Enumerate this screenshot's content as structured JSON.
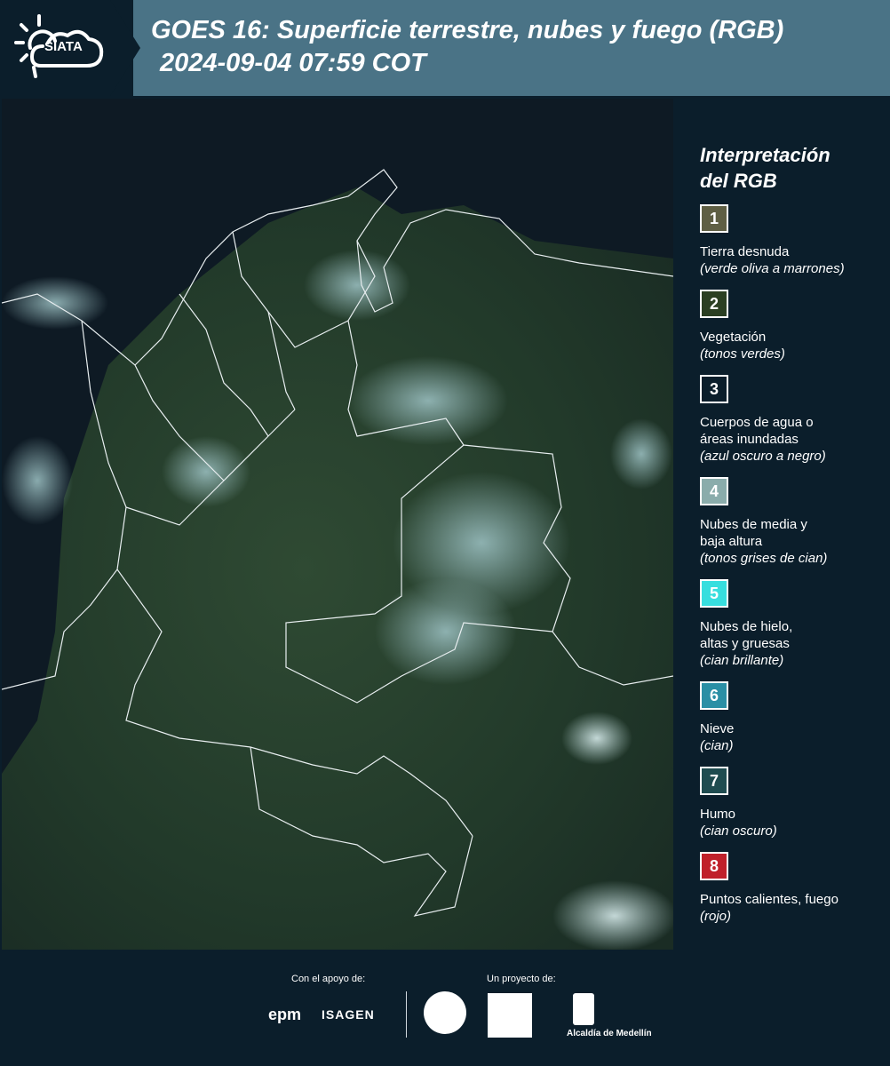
{
  "header": {
    "logo_text": "SIATA",
    "title": "GOES 16: Superficie terrestre, nubes y fuego (RGB)",
    "subtitle": "2024-09-04 07:59 COT"
  },
  "legend": {
    "title_line1": "Interpretación",
    "title_line2": "del RGB",
    "items": [
      {
        "num": "1",
        "color": "#5f5f44",
        "line1": "Tierra desnuda",
        "line2": "",
        "sub": "(verde oliva a marrones)"
      },
      {
        "num": "2",
        "color": "#2b3f22",
        "line1": "Vegetación",
        "line2": "",
        "sub": "(tonos verdes)"
      },
      {
        "num": "3",
        "color": "#0b1e2b",
        "line1": "Cuerpos de agua o",
        "line2": "áreas inundadas",
        "sub": "(azul oscuro a negro)"
      },
      {
        "num": "4",
        "color": "#8aacab",
        "line1": "Nubes de media y",
        "line2": "baja altura",
        "sub": "(tonos grises de cian)"
      },
      {
        "num": "5",
        "color": "#37dede",
        "line1": "Nubes de hielo,",
        "line2": "altas y gruesas",
        "sub": "(cian brillante)"
      },
      {
        "num": "6",
        "color": "#2a8fa5",
        "line1": "Nieve",
        "line2": "",
        "sub": "(cian)"
      },
      {
        "num": "7",
        "color": "#1f4c50",
        "line1": "Humo",
        "line2": "",
        "sub": "(cian oscuro)"
      },
      {
        "num": "8",
        "color": "#c0202a",
        "line1": "Puntos calientes, fuego",
        "line2": "",
        "sub": "(rojo)"
      }
    ]
  },
  "footer": {
    "support_label": "Con el apoyo de:",
    "project_label": "Un proyecto de:",
    "sponsor1": "epm",
    "sponsor2": "ISAGEN",
    "partner_alcaldia": "Alcaldía de Medellín"
  }
}
